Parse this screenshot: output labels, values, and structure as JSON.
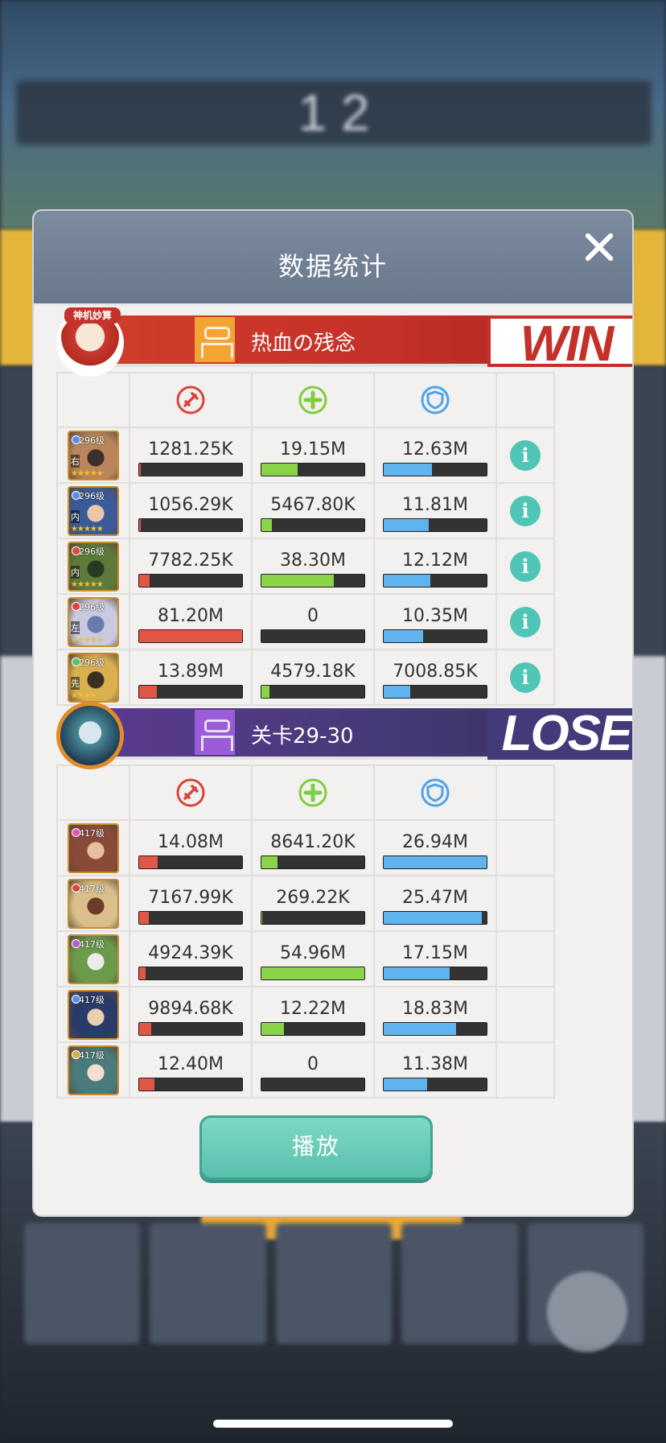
{
  "dialog": {
    "title": "数据统计"
  },
  "play_button": {
    "label": "播放"
  },
  "icons": {
    "close": "close-icon",
    "damage": "sword-icon",
    "heal": "plus-heal-icon",
    "defense": "shield-icon",
    "info": "info-icon"
  },
  "colors": {
    "damage": "#e25645",
    "heal": "#8ad44a",
    "defense": "#5fb4f0",
    "win": "#c4302a",
    "lose": "#433a7a",
    "info": "#4fc5b6"
  },
  "teams": [
    {
      "name": "热血の残念",
      "result": "WIN",
      "avatar_tag": "神机妙算",
      "heroes": [
        {
          "level": "296级",
          "position": "右",
          "stars": "★★★★★",
          "damage": "1281.25K",
          "heal": "19.15M",
          "defense": "12.63M",
          "damage_pct": 1.6,
          "heal_pct": 35,
          "defense_pct": 47
        },
        {
          "level": "296级",
          "position": "内",
          "stars": "★★★★★",
          "damage": "1056.29K",
          "heal": "5467.80K",
          "defense": "11.81M",
          "damage_pct": 1.3,
          "heal_pct": 10,
          "defense_pct": 44
        },
        {
          "level": "296级",
          "position": "内",
          "stars": "★★★★★",
          "damage": "7782.25K",
          "heal": "38.30M",
          "defense": "12.12M",
          "damage_pct": 10,
          "heal_pct": 70,
          "defense_pct": 45
        },
        {
          "level": "296级",
          "position": "左",
          "stars": "★★★★★",
          "damage": "81.20M",
          "heal": "0",
          "defense": "10.35M",
          "damage_pct": 100,
          "heal_pct": 0,
          "defense_pct": 38
        },
        {
          "level": "296级",
          "position": "先",
          "stars": "★★★★",
          "damage": "13.89M",
          "heal": "4579.18K",
          "defense": "7008.85K",
          "damage_pct": 17,
          "heal_pct": 8,
          "defense_pct": 26
        }
      ]
    },
    {
      "name": "关卡29-30",
      "result": "LOSE",
      "heroes": [
        {
          "level": "417级",
          "damage": "14.08M",
          "heal": "8641.20K",
          "defense": "26.94M",
          "damage_pct": 18,
          "heal_pct": 16,
          "defense_pct": 100
        },
        {
          "level": "417级",
          "damage": "7167.99K",
          "heal": "269.22K",
          "defense": "25.47M",
          "damage_pct": 9,
          "heal_pct": 1,
          "defense_pct": 95
        },
        {
          "level": "417级",
          "damage": "4924.39K",
          "heal": "54.96M",
          "defense": "17.15M",
          "damage_pct": 6,
          "heal_pct": 100,
          "defense_pct": 64
        },
        {
          "level": "417级",
          "damage": "9894.68K",
          "heal": "12.22M",
          "defense": "18.83M",
          "damage_pct": 12,
          "heal_pct": 22,
          "defense_pct": 70
        },
        {
          "level": "417级",
          "damage": "12.40M",
          "heal": "0",
          "defense": "11.38M",
          "damage_pct": 15,
          "heal_pct": 0,
          "defense_pct": 42
        }
      ]
    }
  ]
}
